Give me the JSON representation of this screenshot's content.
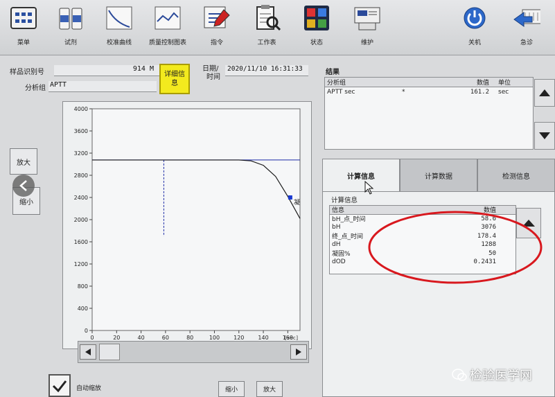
{
  "toolbar": {
    "items": [
      {
        "label": "菜单",
        "icon": "menu-icon"
      },
      {
        "label": "试剂",
        "icon": "reagent-icon"
      },
      {
        "label": "校准曲线",
        "icon": "calibration-curve-icon"
      },
      {
        "label": "质量控制图表",
        "icon": "qc-chart-icon"
      },
      {
        "label": "指令",
        "icon": "order-icon"
      },
      {
        "label": "工作表",
        "icon": "worksheet-icon"
      },
      {
        "label": "状态",
        "icon": "status-icon"
      },
      {
        "label": "维护",
        "icon": "maintenance-icon"
      },
      {
        "label": "关机",
        "icon": "power-icon"
      },
      {
        "label": "急诊",
        "icon": "stat-icon"
      }
    ]
  },
  "sample": {
    "id_label": "样品识别号",
    "id_value": "914 M",
    "group_label": "分析组",
    "group_value": "APTT",
    "detail_button": "详细信息",
    "date_label": "日期/",
    "time_label": "时间",
    "datetime_value": "2020/11/10 16:31:33"
  },
  "graph": {
    "zoom_in": "放大",
    "zoom_out": "缩小",
    "marker_label": "凝",
    "x_unit": "[sec]",
    "y_ticks": [
      "4000",
      "3600",
      "3200",
      "2800",
      "2400",
      "2000",
      "1600",
      "1200",
      "800",
      "400",
      "0"
    ],
    "x_ticks": [
      "0",
      "20",
      "40",
      "60",
      "80",
      "100",
      "120",
      "140",
      "160"
    ],
    "auto_zoom_label": "自动缩放",
    "bottom_zoom_out": "缩小",
    "bottom_zoom_in": "放大"
  },
  "chart_data": {
    "type": "line",
    "xlim": [
      0,
      170
    ],
    "ylim": [
      0,
      4000
    ],
    "xlabel": "[sec]",
    "series": [
      {
        "x": [
          0,
          120,
          130,
          140,
          150,
          160,
          170
        ],
        "y": [
          3076,
          3076,
          3060,
          2980,
          2780,
          2420,
          2020
        ]
      }
    ],
    "baseline_y": 3076,
    "vertical_marker_x": 58.6,
    "clot_point": {
      "x": 162,
      "y": 2400
    }
  },
  "results": {
    "title": "结果",
    "columns": [
      "分析组",
      "",
      "数值",
      "单位"
    ],
    "rows": [
      {
        "group": "APTT sec",
        "flag": "*",
        "value": "161.2",
        "unit": "sec"
      }
    ]
  },
  "tabs": [
    {
      "label": "计算信息",
      "active": true
    },
    {
      "label": "计算数据",
      "active": false
    },
    {
      "label": "检测信息",
      "active": false
    }
  ],
  "calc": {
    "title": "计算信息",
    "col_info": "信息",
    "col_value": "数值",
    "rows": [
      {
        "key": "bH_点_时间",
        "value": "58.6"
      },
      {
        "key": "bH",
        "value": "3076"
      },
      {
        "key": "终_点_时间",
        "value": "178.4"
      },
      {
        "key": "dH",
        "value": "1288"
      },
      {
        "key": "凝固%",
        "value": "50"
      },
      {
        "key": "dOD",
        "value": "0.2431"
      }
    ]
  },
  "watermark": "检验医学网",
  "colors": {
    "annotation_circle": "#d8181e",
    "curve": "#1a1a1a",
    "guide_line": "#1b2aa6",
    "detail_button": "#f3ea1e"
  }
}
